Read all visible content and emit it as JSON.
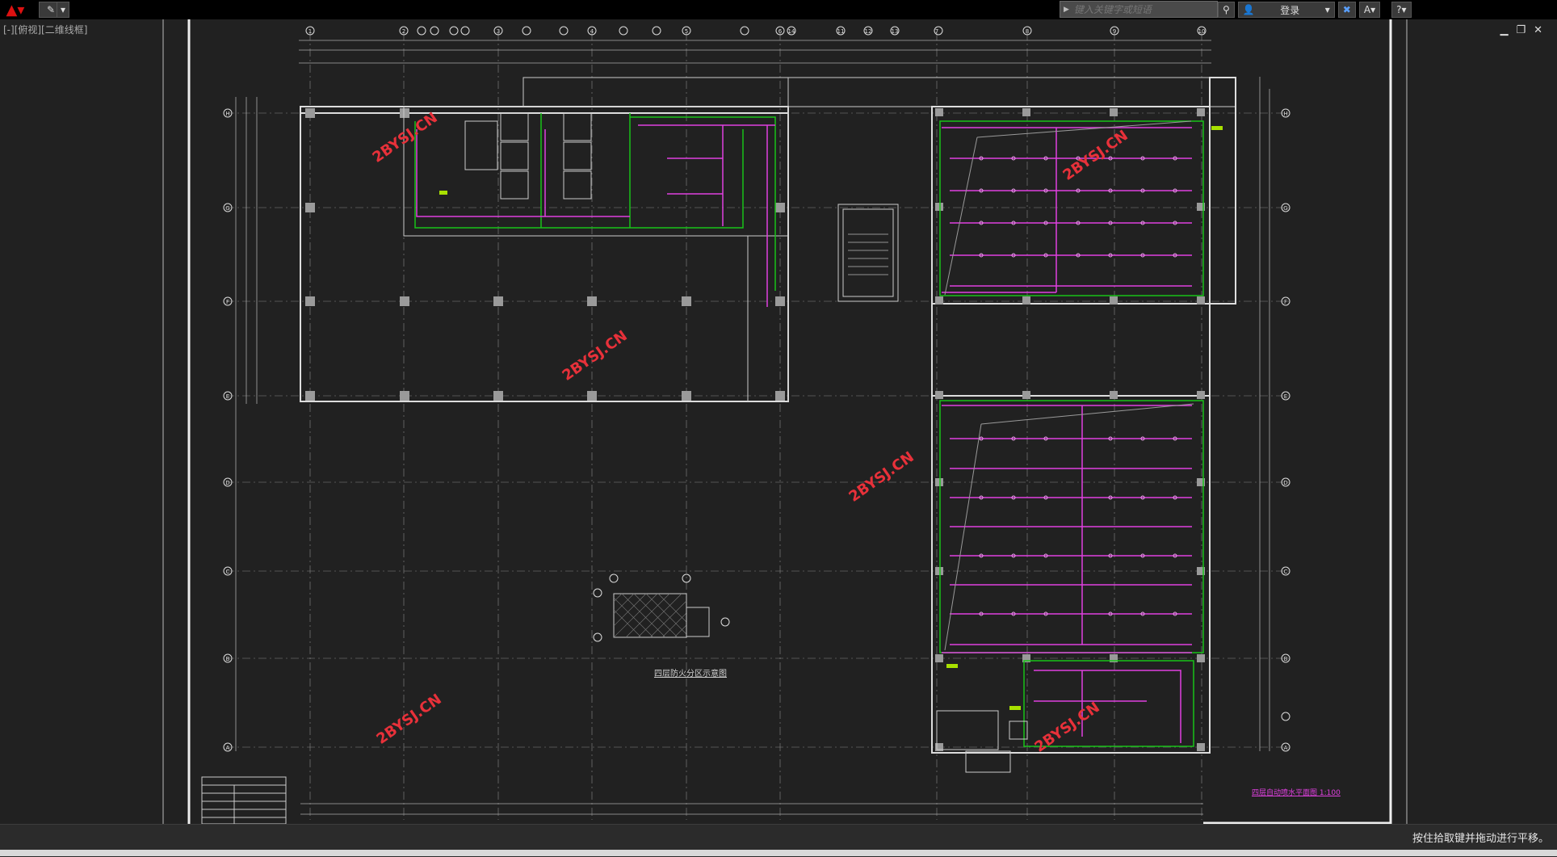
{
  "titlebar": {
    "search_placeholder": "键入关键字或短语",
    "login_label": "登录"
  },
  "viewport": {
    "label": "[-][俯视][二维线框]"
  },
  "drawing": {
    "watermark": "2BYSJ.CN",
    "plan_title": "四层自动喷水平面图",
    "plan_scale": "1:100",
    "fire_zone_title": "四层防火分区示意图",
    "grid_top": [
      "1",
      "2",
      "3",
      "4",
      "5",
      "6",
      "7",
      "8",
      "9",
      "10",
      "11",
      "12",
      "13",
      "14"
    ],
    "grid_side": [
      "H",
      "G",
      "F",
      "E",
      "D",
      "C",
      "B",
      "A"
    ]
  },
  "status": {
    "message": "按住拾取键并拖动进行平移。"
  },
  "colors": {
    "background": "#212121",
    "sprinkler_pipe": "#e040e0",
    "wall": "#d8d8d8",
    "green_line": "#19c219",
    "watermark": "#e8313a",
    "titlebar": "#000000"
  }
}
